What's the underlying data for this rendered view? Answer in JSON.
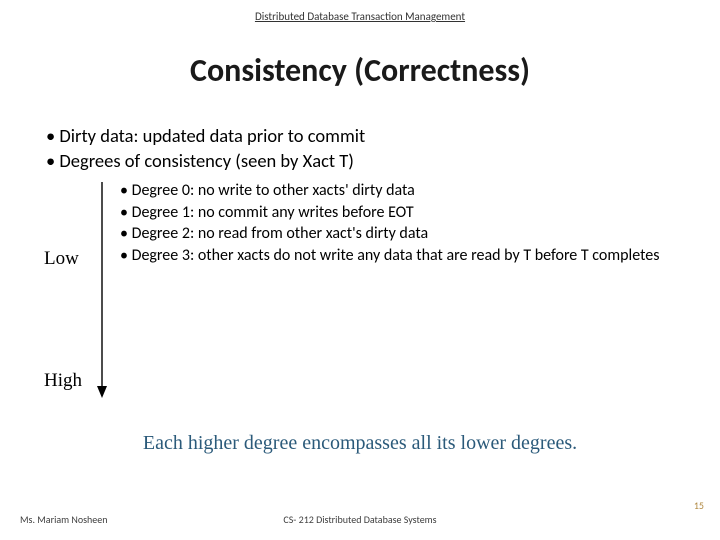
{
  "header": {
    "topic": "Distributed Database Transaction Management"
  },
  "title": "Consistency (Correctness)",
  "bullets": {
    "main": [
      "Dirty data: updated data prior to commit",
      "Degrees of consistency (seen by Xact T)"
    ],
    "sub": [
      "Degree 0: no write to other xacts' dirty data",
      "Degree 1: no commit any writes before EOT",
      "Degree 2: no read from other xact's dirty data",
      "Degree 3: other xacts do not write any data that are read by T before T completes"
    ]
  },
  "labels": {
    "low": "Low",
    "high": "High"
  },
  "summary": "Each higher degree encompasses all its lower degrees.",
  "footer": {
    "author": "Ms. Mariam Nosheen",
    "course": "CS- 212 Distributed Database Systems",
    "page": "15"
  }
}
